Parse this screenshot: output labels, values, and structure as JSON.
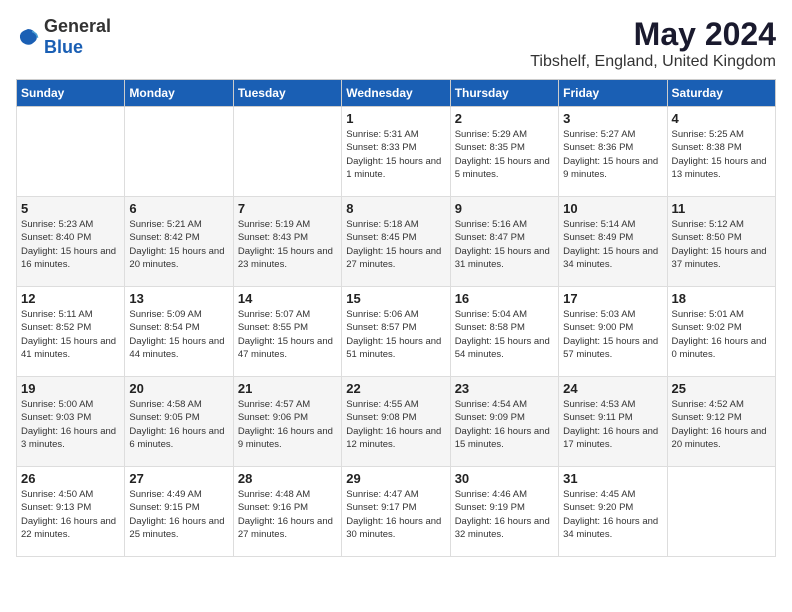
{
  "logo": {
    "text_general": "General",
    "text_blue": "Blue"
  },
  "title": {
    "month": "May 2024",
    "location": "Tibshelf, England, United Kingdom"
  },
  "weekdays": [
    "Sunday",
    "Monday",
    "Tuesday",
    "Wednesday",
    "Thursday",
    "Friday",
    "Saturday"
  ],
  "weeks": [
    [
      {
        "day": "",
        "content": ""
      },
      {
        "day": "",
        "content": ""
      },
      {
        "day": "",
        "content": ""
      },
      {
        "day": "1",
        "content": "Sunrise: 5:31 AM\nSunset: 8:33 PM\nDaylight: 15 hours\nand 1 minute."
      },
      {
        "day": "2",
        "content": "Sunrise: 5:29 AM\nSunset: 8:35 PM\nDaylight: 15 hours\nand 5 minutes."
      },
      {
        "day": "3",
        "content": "Sunrise: 5:27 AM\nSunset: 8:36 PM\nDaylight: 15 hours\nand 9 minutes."
      },
      {
        "day": "4",
        "content": "Sunrise: 5:25 AM\nSunset: 8:38 PM\nDaylight: 15 hours\nand 13 minutes."
      }
    ],
    [
      {
        "day": "5",
        "content": "Sunrise: 5:23 AM\nSunset: 8:40 PM\nDaylight: 15 hours\nand 16 minutes."
      },
      {
        "day": "6",
        "content": "Sunrise: 5:21 AM\nSunset: 8:42 PM\nDaylight: 15 hours\nand 20 minutes."
      },
      {
        "day": "7",
        "content": "Sunrise: 5:19 AM\nSunset: 8:43 PM\nDaylight: 15 hours\nand 23 minutes."
      },
      {
        "day": "8",
        "content": "Sunrise: 5:18 AM\nSunset: 8:45 PM\nDaylight: 15 hours\nand 27 minutes."
      },
      {
        "day": "9",
        "content": "Sunrise: 5:16 AM\nSunset: 8:47 PM\nDaylight: 15 hours\nand 31 minutes."
      },
      {
        "day": "10",
        "content": "Sunrise: 5:14 AM\nSunset: 8:49 PM\nDaylight: 15 hours\nand 34 minutes."
      },
      {
        "day": "11",
        "content": "Sunrise: 5:12 AM\nSunset: 8:50 PM\nDaylight: 15 hours\nand 37 minutes."
      }
    ],
    [
      {
        "day": "12",
        "content": "Sunrise: 5:11 AM\nSunset: 8:52 PM\nDaylight: 15 hours\nand 41 minutes."
      },
      {
        "day": "13",
        "content": "Sunrise: 5:09 AM\nSunset: 8:54 PM\nDaylight: 15 hours\nand 44 minutes."
      },
      {
        "day": "14",
        "content": "Sunrise: 5:07 AM\nSunset: 8:55 PM\nDaylight: 15 hours\nand 47 minutes."
      },
      {
        "day": "15",
        "content": "Sunrise: 5:06 AM\nSunset: 8:57 PM\nDaylight: 15 hours\nand 51 minutes."
      },
      {
        "day": "16",
        "content": "Sunrise: 5:04 AM\nSunset: 8:58 PM\nDaylight: 15 hours\nand 54 minutes."
      },
      {
        "day": "17",
        "content": "Sunrise: 5:03 AM\nSunset: 9:00 PM\nDaylight: 15 hours\nand 57 minutes."
      },
      {
        "day": "18",
        "content": "Sunrise: 5:01 AM\nSunset: 9:02 PM\nDaylight: 16 hours\nand 0 minutes."
      }
    ],
    [
      {
        "day": "19",
        "content": "Sunrise: 5:00 AM\nSunset: 9:03 PM\nDaylight: 16 hours\nand 3 minutes."
      },
      {
        "day": "20",
        "content": "Sunrise: 4:58 AM\nSunset: 9:05 PM\nDaylight: 16 hours\nand 6 minutes."
      },
      {
        "day": "21",
        "content": "Sunrise: 4:57 AM\nSunset: 9:06 PM\nDaylight: 16 hours\nand 9 minutes."
      },
      {
        "day": "22",
        "content": "Sunrise: 4:55 AM\nSunset: 9:08 PM\nDaylight: 16 hours\nand 12 minutes."
      },
      {
        "day": "23",
        "content": "Sunrise: 4:54 AM\nSunset: 9:09 PM\nDaylight: 16 hours\nand 15 minutes."
      },
      {
        "day": "24",
        "content": "Sunrise: 4:53 AM\nSunset: 9:11 PM\nDaylight: 16 hours\nand 17 minutes."
      },
      {
        "day": "25",
        "content": "Sunrise: 4:52 AM\nSunset: 9:12 PM\nDaylight: 16 hours\nand 20 minutes."
      }
    ],
    [
      {
        "day": "26",
        "content": "Sunrise: 4:50 AM\nSunset: 9:13 PM\nDaylight: 16 hours\nand 22 minutes."
      },
      {
        "day": "27",
        "content": "Sunrise: 4:49 AM\nSunset: 9:15 PM\nDaylight: 16 hours\nand 25 minutes."
      },
      {
        "day": "28",
        "content": "Sunrise: 4:48 AM\nSunset: 9:16 PM\nDaylight: 16 hours\nand 27 minutes."
      },
      {
        "day": "29",
        "content": "Sunrise: 4:47 AM\nSunset: 9:17 PM\nDaylight: 16 hours\nand 30 minutes."
      },
      {
        "day": "30",
        "content": "Sunrise: 4:46 AM\nSunset: 9:19 PM\nDaylight: 16 hours\nand 32 minutes."
      },
      {
        "day": "31",
        "content": "Sunrise: 4:45 AM\nSunset: 9:20 PM\nDaylight: 16 hours\nand 34 minutes."
      },
      {
        "day": "",
        "content": ""
      }
    ]
  ]
}
